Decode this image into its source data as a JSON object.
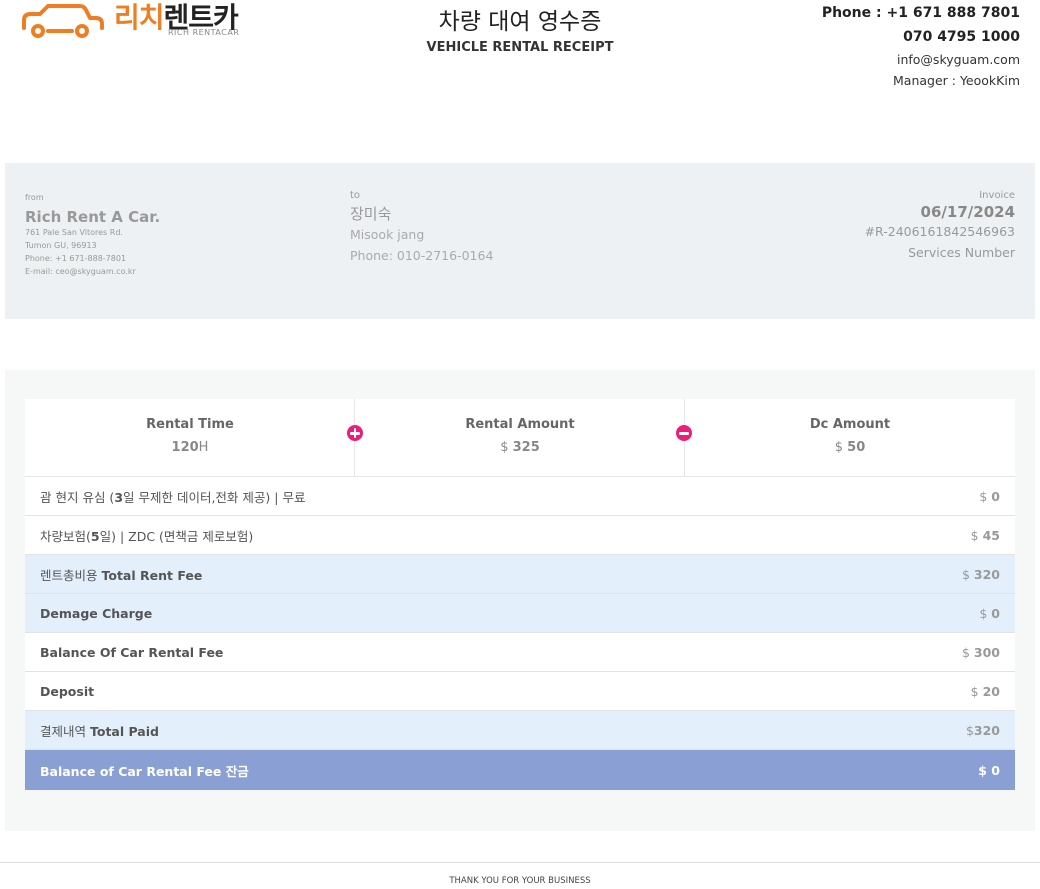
{
  "header": {
    "logo_korean_1": "리치",
    "logo_korean_2": "렌트카",
    "logo_english": "RICH RENTACAR",
    "title": "차량 대여 영수증",
    "subtitle": "VEHICLE RENTAL RECEIPT",
    "phone": "Phone : +1 671 888 7801",
    "phone2": "070 4795 1000",
    "email": "info@skyguam.com",
    "manager": "Manager : YeookKim"
  },
  "from": {
    "label": "from",
    "name": "Rich Rent A Car.",
    "address1": "761 Pale San Vitores Rd.",
    "address2": "Tumon GU, 96913",
    "phone": "Phone: +1 671-888-7801",
    "email": "E-mail: ceo@skyguam.co.kr"
  },
  "to": {
    "label": "to",
    "name_ko": "장미숙",
    "name_en": "Misook jang",
    "phone": "Phone: 010-2716-0164"
  },
  "invoice": {
    "label": "Invoice",
    "date": "06/17/2024",
    "number": "#R-2406161842546963",
    "services": "Services Number"
  },
  "summary": {
    "rental_time_label": "Rental Time",
    "rental_time_value": "120",
    "rental_time_unit": "H",
    "rental_amount_label": "Rental Amount",
    "rental_amount_currency": "$",
    "rental_amount_value": "325",
    "dc_amount_label": "Dc Amount",
    "dc_amount_currency": "$",
    "dc_amount_value": "50"
  },
  "rows": [
    {
      "pre": "괌 현지 유심 (",
      "bold": "3",
      "post": "일 무제한 데이터,전화 제공) | 무료",
      "currency": "$",
      "amount": "0"
    },
    {
      "pre": "차량보험(",
      "bold": "5",
      "post": "일) | ZDC (면책금 제로보험)",
      "currency": "$",
      "amount": "45"
    },
    {
      "pre": "렌트총비용 ",
      "bold": "Total Rent Fee",
      "post": "",
      "currency": "$",
      "amount": "320"
    },
    {
      "pre": "",
      "bold": "Demage Charge",
      "post": "",
      "currency": "$",
      "amount": "0"
    },
    {
      "pre": "",
      "bold": "Balance Of Car Rental Fee",
      "post": "",
      "currency": "$",
      "amount": "300"
    },
    {
      "pre": "",
      "bold": "Deposit",
      "post": "",
      "currency": "$",
      "amount": "20"
    },
    {
      "pre": "결제내역 ",
      "bold": "Total Paid",
      "post": "",
      "currency": "$",
      "amount": "320"
    },
    {
      "pre": "",
      "bold": "Balance of Car Rental Fee 잔금",
      "post": "",
      "currency": "$",
      "amount": "0"
    }
  ],
  "footer": "THANK YOU FOR YOUR BUSINESS"
}
